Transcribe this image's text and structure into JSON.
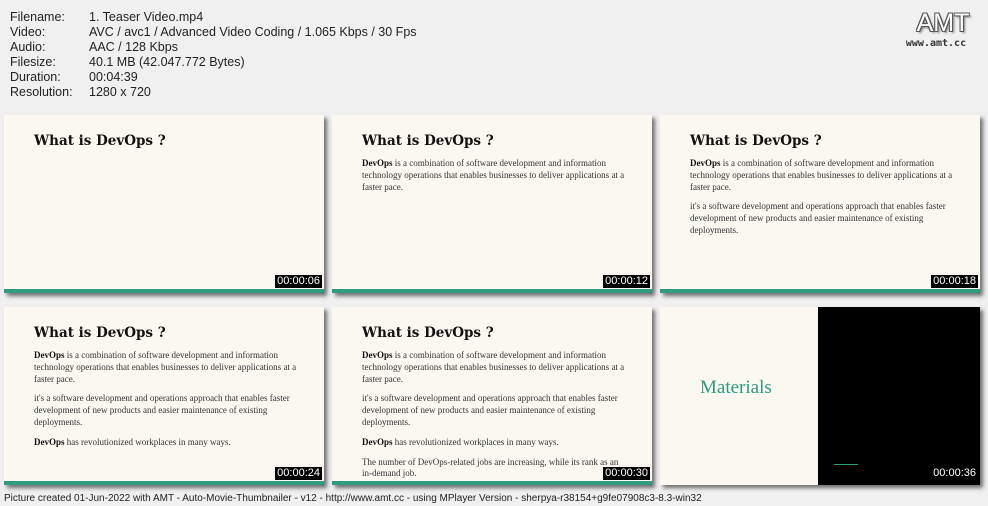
{
  "info": {
    "filename_label": "Filename:",
    "filename": "1. Teaser Video.mp4",
    "video_label": "Video:",
    "video": "AVC / avc1 / Advanced Video Coding / 1.065 Kbps / 30 Fps",
    "audio_label": "Audio:",
    "audio": "AAC / 128 Kbps",
    "filesize_label": "Filesize:",
    "filesize": "40.1 MB (42.047.772 Bytes)",
    "duration_label": "Duration:",
    "duration": "00:04:39",
    "resolution_label": "Resolution:",
    "resolution": "1280 x 720"
  },
  "logo": {
    "text": "AMT",
    "url": "www.amt.cc"
  },
  "slide": {
    "title": "What is DevOps ?",
    "p1_bold": "DevOps",
    "p1_rest": " is a combination of software development and information technology operations that enables businesses to deliver applications at a faster pace.",
    "p2": "it's a software development and operations approach that enables faster development of new products and easier maintenance of existing deployments.",
    "p3_bold": "DevOps",
    "p3_rest": " has revolutionized workplaces in many ways.",
    "p4": "The number of DevOps-related jobs are increasing, while its rank as an in-demand job.",
    "materials": "Materials"
  },
  "timestamps": [
    "00:00:06",
    "00:00:12",
    "00:00:18",
    "00:00:24",
    "00:00:30",
    "00:00:36"
  ],
  "colors": {
    "accent": "#2c9b7e",
    "slide_bg": "#fbf8f2"
  },
  "footer": "Picture created 01-Jun-2022 with AMT - Auto-Movie-Thumbnailer - v12 - http://www.amt.cc - using MPlayer Version - sherpya-r38154+g9fe07908c3-8.3-win32"
}
